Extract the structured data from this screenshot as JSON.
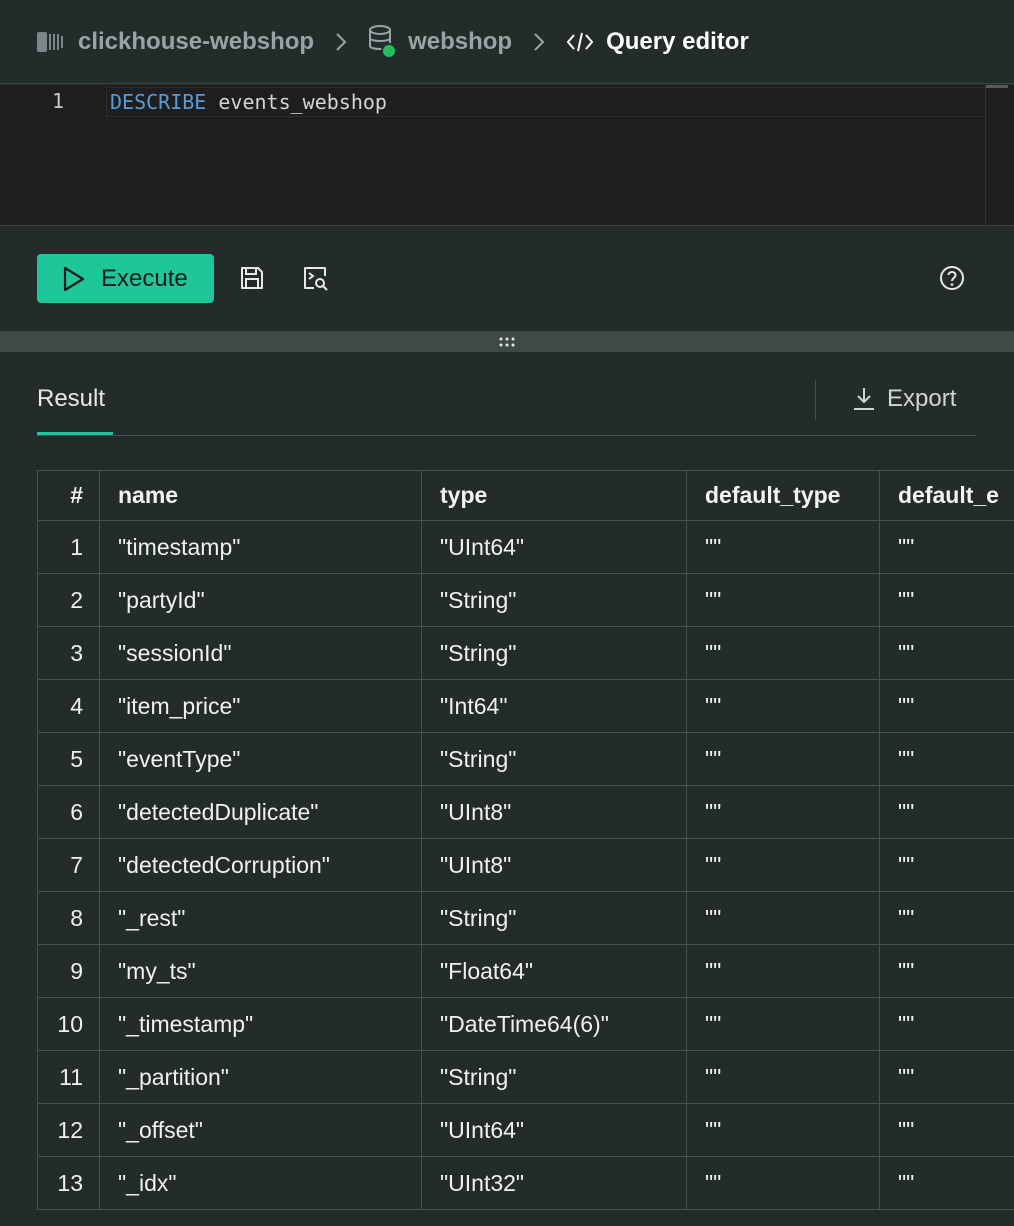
{
  "breadcrumb": {
    "service": "clickhouse-webshop",
    "database": "webshop",
    "page": "Query editor"
  },
  "editor": {
    "line_number": "1",
    "keyword": "DESCRIBE",
    "table_name": "events_webshop"
  },
  "toolbar": {
    "execute_label": "Execute"
  },
  "results": {
    "tab_label": "Result",
    "export_label": "Export",
    "columns": [
      "#",
      "name",
      "type",
      "default_type",
      "default_e"
    ],
    "rows": [
      [
        "1",
        "\"timestamp\"",
        "\"UInt64\"",
        "\"\"",
        "\"\""
      ],
      [
        "2",
        "\"partyId\"",
        "\"String\"",
        "\"\"",
        "\"\""
      ],
      [
        "3",
        "\"sessionId\"",
        "\"String\"",
        "\"\"",
        "\"\""
      ],
      [
        "4",
        "\"item_price\"",
        "\"Int64\"",
        "\"\"",
        "\"\""
      ],
      [
        "5",
        "\"eventType\"",
        "\"String\"",
        "\"\"",
        "\"\""
      ],
      [
        "6",
        "\"detectedDuplicate\"",
        "\"UInt8\"",
        "\"\"",
        "\"\""
      ],
      [
        "7",
        "\"detectedCorruption\"",
        "\"UInt8\"",
        "\"\"",
        "\"\""
      ],
      [
        "8",
        "\"_rest\"",
        "\"String\"",
        "\"\"",
        "\"\""
      ],
      [
        "9",
        "\"my_ts\"",
        "\"Float64\"",
        "\"\"",
        "\"\""
      ],
      [
        "10",
        "\"_timestamp\"",
        "\"DateTime64(6)\"",
        "\"\"",
        "\"\""
      ],
      [
        "11",
        "\"_partition\"",
        "\"String\"",
        "\"\"",
        "\"\""
      ],
      [
        "12",
        "\"_offset\"",
        "\"UInt64\"",
        "\"\"",
        "\"\""
      ],
      [
        "13",
        "\"_idx\"",
        "\"UInt32\"",
        "\"\"",
        "\"\""
      ]
    ]
  },
  "colors": {
    "accent": "#1ec79a",
    "background": "#242b2b",
    "editor_background": "#1e1e1e",
    "keyword": "#569cd6",
    "status_dot": "#1fc05a"
  },
  "icons": {
    "service": "server-icon",
    "database": "database-icon",
    "page": "code-icon",
    "execute": "play-icon",
    "save": "save-icon",
    "format": "terminal-search-icon",
    "help": "help-circle-icon",
    "export": "download-icon",
    "splitter": "drag-handle-icon"
  }
}
